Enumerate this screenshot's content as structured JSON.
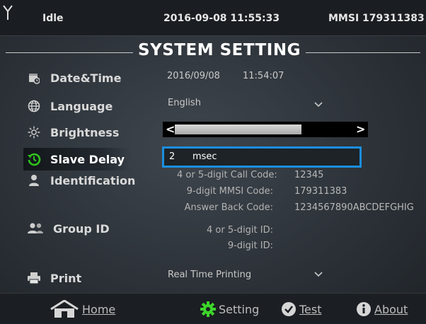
{
  "status": {
    "state": "Idle",
    "datetime": "2016-09-08 11:55:33",
    "mmsi": "MMSI 179311383",
    "icon": "antenna-icon"
  },
  "title": "SYSTEM SETTING",
  "menu": [
    {
      "label": "Date&Time",
      "icon": "calendar-clock-icon"
    },
    {
      "label": "Language",
      "icon": "globe-icon"
    },
    {
      "label": "Brightness",
      "icon": "sun-icon"
    },
    {
      "label": "Slave Delay",
      "icon": "history-icon",
      "active": true
    },
    {
      "label": "Identification",
      "icon": "person-icon"
    },
    {
      "label": "Group ID",
      "icon": "group-icon"
    },
    {
      "label": "Print",
      "icon": "printer-icon"
    }
  ],
  "datetime": {
    "date": "2016/09/08",
    "time": "11:54:07"
  },
  "language": {
    "value": "English"
  },
  "brightness": {
    "level": 0.7,
    "left_arrow": "<",
    "right_arrow": ">"
  },
  "slave_delay": {
    "value": "2",
    "unit": "msec"
  },
  "identification": {
    "call_code_label": "4 or 5-digit Call Code:",
    "call_code": "12345",
    "mmsi_label": "9-digit MMSI Code:",
    "mmsi": "179311383",
    "answer_back_label": "Answer Back Code:",
    "answer_back": "1234567890ABCDEFGHIG"
  },
  "group_id": {
    "id5_label": "4 or 5-digit ID:",
    "id9_label": "9-digit ID:"
  },
  "print": {
    "value": "Real Time Printing"
  },
  "bottom": {
    "home": "Home",
    "setting": "Setting",
    "test": "Test",
    "about": "About"
  },
  "colors": {
    "accent": "#1b8fe0",
    "setting_green": "#3dd62a",
    "history_green": "#2fc31c"
  }
}
